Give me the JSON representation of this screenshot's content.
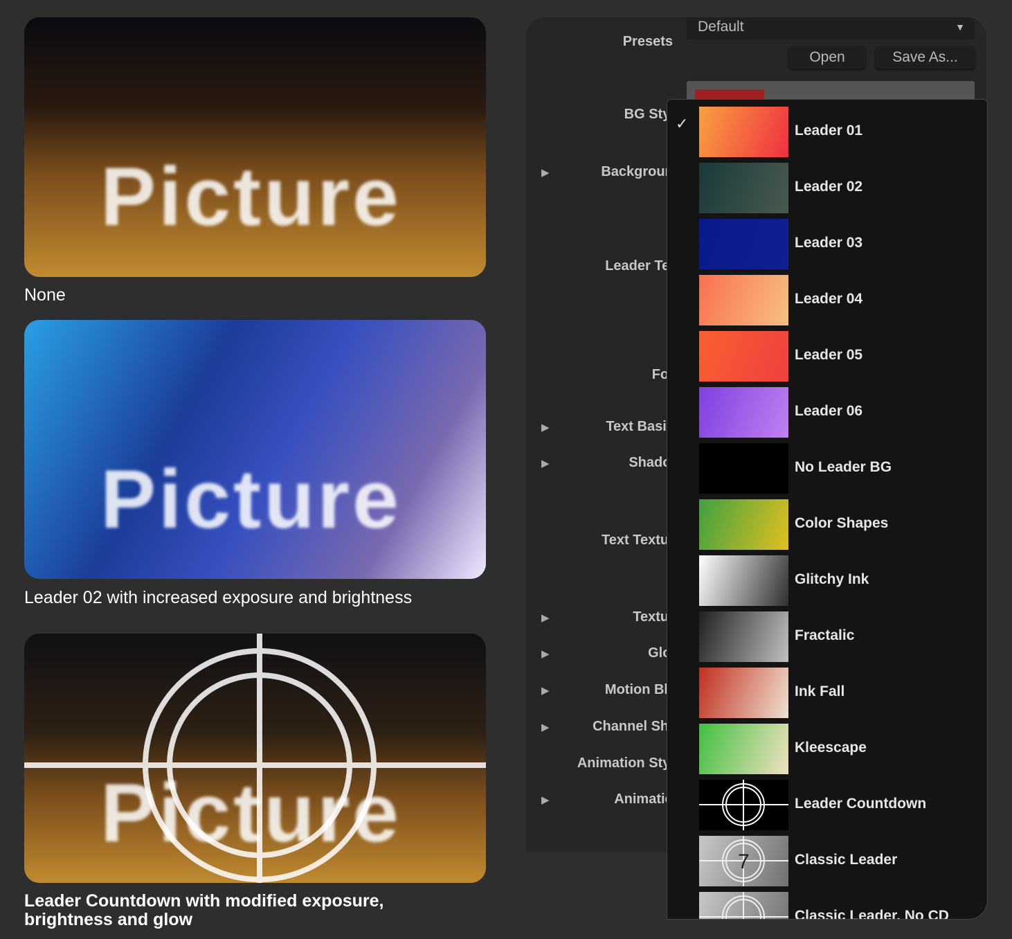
{
  "examples": [
    {
      "overlay_text": "Picture",
      "caption": "None"
    },
    {
      "overlay_text": "Picture",
      "caption": "Leader 02 with increased exposure and brightness"
    },
    {
      "overlay_text": "Picture",
      "caption": "Leader Countdown with modified exposure, brightness and glow"
    }
  ],
  "inspector": {
    "presets_label": "Presets",
    "presets_value": "Default",
    "open_label": "Open",
    "save_as_label": "Save As...",
    "rows": [
      {
        "label": "BG Style",
        "disclosure": false
      },
      {
        "label": "Background",
        "disclosure": true
      },
      {
        "label": "Leader Text",
        "disclosure": false
      },
      {
        "label": "Font",
        "disclosure": false
      },
      {
        "label": "Text Basics",
        "disclosure": true
      },
      {
        "label": "Shadow",
        "disclosure": true
      },
      {
        "label": "Text Texture",
        "disclosure": false
      },
      {
        "label": "Texture",
        "disclosure": true
      },
      {
        "label": "Glow",
        "disclosure": true
      },
      {
        "label": "Motion Blur",
        "disclosure": true
      },
      {
        "label": "Channel Shift",
        "disclosure": true
      },
      {
        "label": "Animation Style",
        "disclosure": false
      },
      {
        "label": "Animation",
        "disclosure": true
      }
    ]
  },
  "bg_style_menu": {
    "selected": "Leader 01",
    "check_glyph": "✓",
    "items": [
      {
        "label": "Leader 01",
        "colors": [
          "#f8a040",
          "#f03040"
        ]
      },
      {
        "label": "Leader 02",
        "colors": [
          "#1a3a3a",
          "#4a5a50"
        ]
      },
      {
        "label": "Leader 03",
        "colors": [
          "#0a1a8a",
          "#102090"
        ]
      },
      {
        "label": "Leader 04",
        "colors": [
          "#f87050",
          "#f8c080"
        ]
      },
      {
        "label": "Leader 05",
        "colors": [
          "#f86030",
          "#f04040"
        ]
      },
      {
        "label": "Leader 06",
        "colors": [
          "#8040e0",
          "#c080f0"
        ]
      },
      {
        "label": "No Leader BG",
        "colors": [
          "#000000",
          "#000000"
        ]
      },
      {
        "label": "Color Shapes",
        "colors": [
          "#40a040",
          "#e0c020"
        ]
      },
      {
        "label": "Glitchy Ink",
        "colors": [
          "#ffffff",
          "#303030"
        ]
      },
      {
        "label": "Fractalic",
        "colors": [
          "#202020",
          "#c0c0c0"
        ]
      },
      {
        "label": "Ink Fall",
        "colors": [
          "#c03020",
          "#f0e0d0"
        ]
      },
      {
        "label": "Kleescape",
        "colors": [
          "#40c040",
          "#f0e0c0"
        ]
      },
      {
        "label": "Leader Countdown",
        "colors": [
          "#000000",
          "#000000"
        ]
      },
      {
        "label": "Classic Leader",
        "colors": [
          "#c8c8c8",
          "#707070"
        ]
      },
      {
        "label": "Classic Leader, No CD",
        "colors": [
          "#c8c8c8",
          "#707070"
        ]
      }
    ]
  }
}
